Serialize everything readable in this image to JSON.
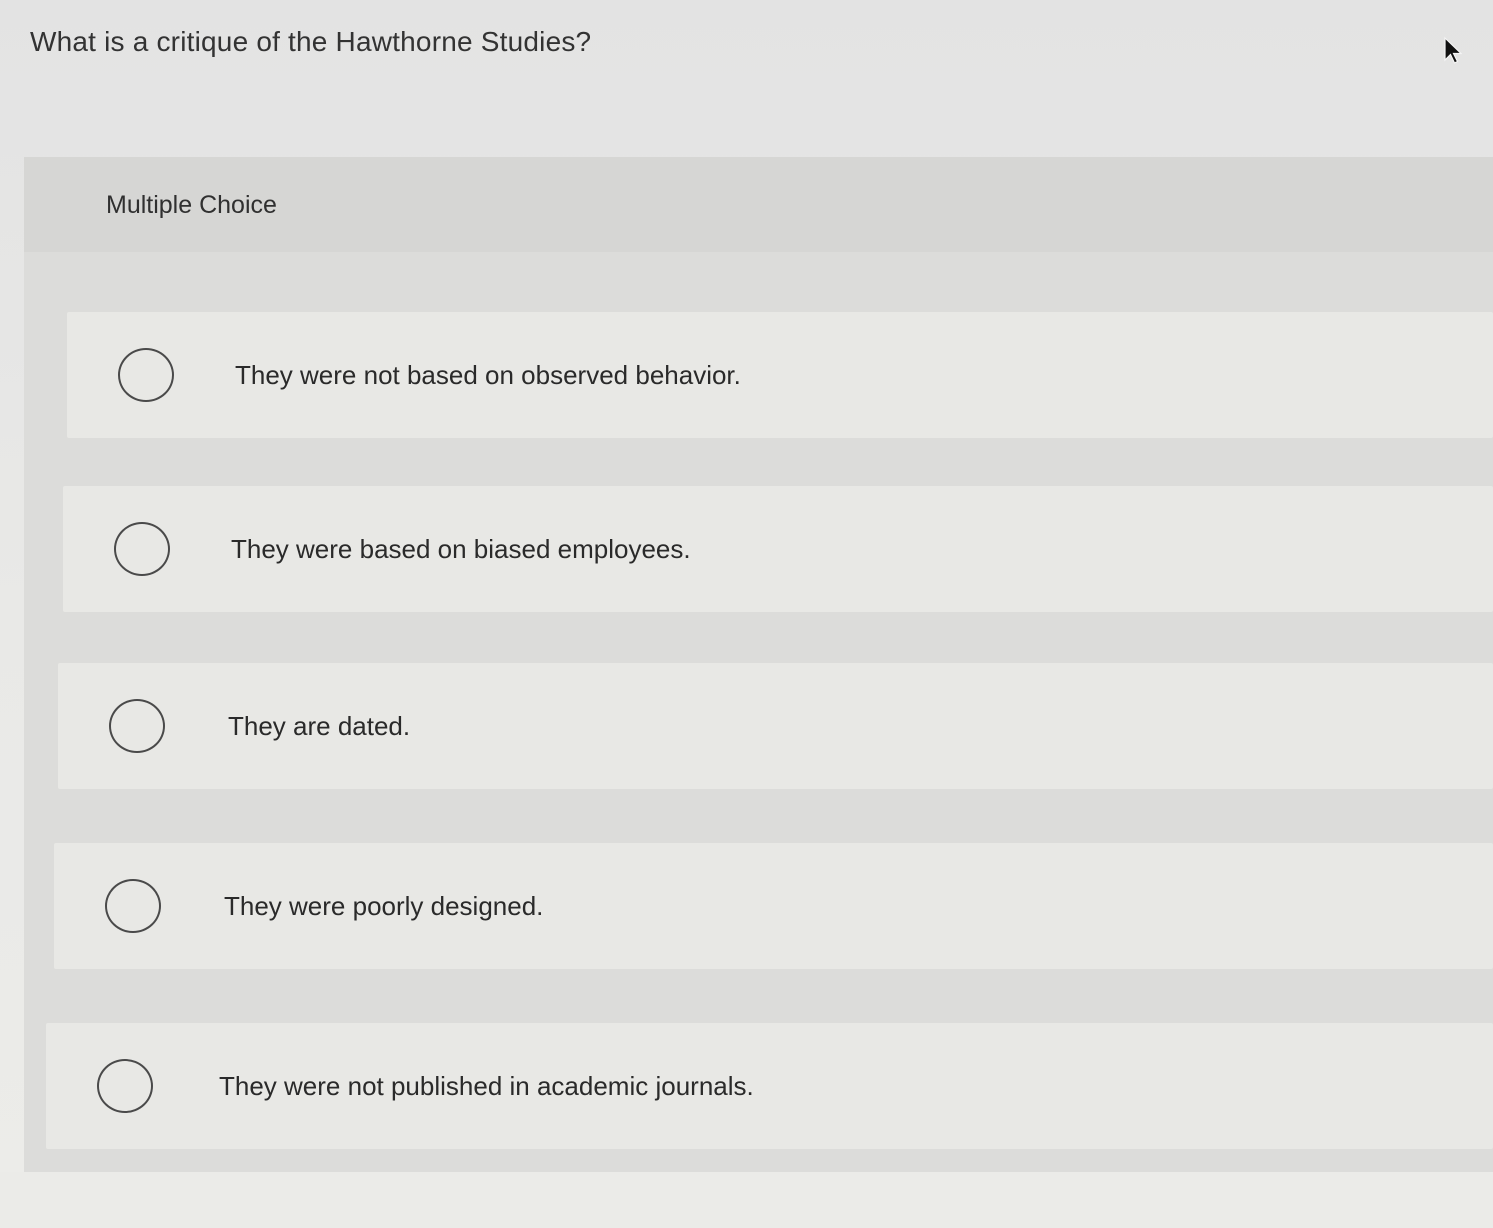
{
  "question": {
    "text": "What is a critique of the Hawthorne Studies?"
  },
  "panel": {
    "label": "Multiple Choice"
  },
  "options": [
    {
      "label": "They were not based on observed behavior.",
      "selected": false
    },
    {
      "label": "They were based on biased employees.",
      "selected": false
    },
    {
      "label": "They are dated.",
      "selected": false
    },
    {
      "label": "They were poorly designed.",
      "selected": false
    },
    {
      "label": "They were not published in academic journals.",
      "selected": false
    }
  ],
  "icons": {
    "cursor": "mouse-pointer-icon",
    "radio": "radio-unselected-icon"
  },
  "colors": {
    "radio_border": "#4a4a4a",
    "text": "#2a2a2a"
  }
}
